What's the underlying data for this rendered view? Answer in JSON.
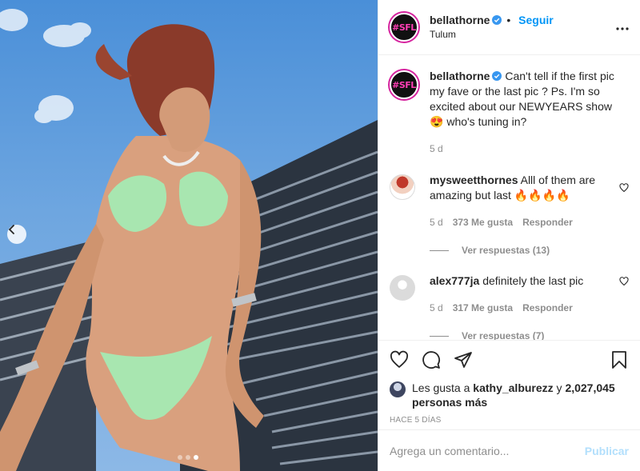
{
  "post": {
    "username": "bellathorne",
    "follow_label": "Seguir",
    "separator": "•",
    "location": "Tulum",
    "more_label": "•••",
    "avatar_text": "#SFL"
  },
  "caption": {
    "username": "bellathorne",
    "text": "Can't tell if the first pic my fave or the last pic ? Ps. I'm so excited about our NEWYEARS show",
    "emoji": "😍",
    "text_after": "who's tuning in?",
    "age": "5 d"
  },
  "comments": [
    {
      "username": "mysweetthornes",
      "text": "Alll of them are amazing but last",
      "emoji": "🔥🔥🔥🔥",
      "age": "5 d",
      "likes": "373 Me gusta",
      "reply_label": "Responder",
      "view_replies": "Ver respuestas (13)"
    },
    {
      "username": "alex777ja",
      "text": "definitely the last pic",
      "age": "5 d",
      "likes": "317 Me gusta",
      "reply_label": "Responder",
      "view_replies": "Ver respuestas (7)"
    }
  ],
  "likes": {
    "prefix": "Les gusta a",
    "user": "kathy_alburezz",
    "conj": "y",
    "count": "2,027,045 personas más"
  },
  "timestamp": "HACE 5 DÍAS",
  "add_comment": {
    "placeholder": "Agrega un comentario...",
    "publish_label": "Publicar"
  },
  "carousel": {
    "current_index": 3,
    "total": 3
  },
  "colors": {
    "accent": "#0095f6",
    "publish_disabled": "#b2dffc",
    "muted": "#8e8e8e",
    "text": "#262626"
  },
  "icons": [
    "verified-icon",
    "more-icon",
    "heart-icon",
    "comment-icon",
    "share-icon",
    "save-icon",
    "chevron-left-icon"
  ]
}
